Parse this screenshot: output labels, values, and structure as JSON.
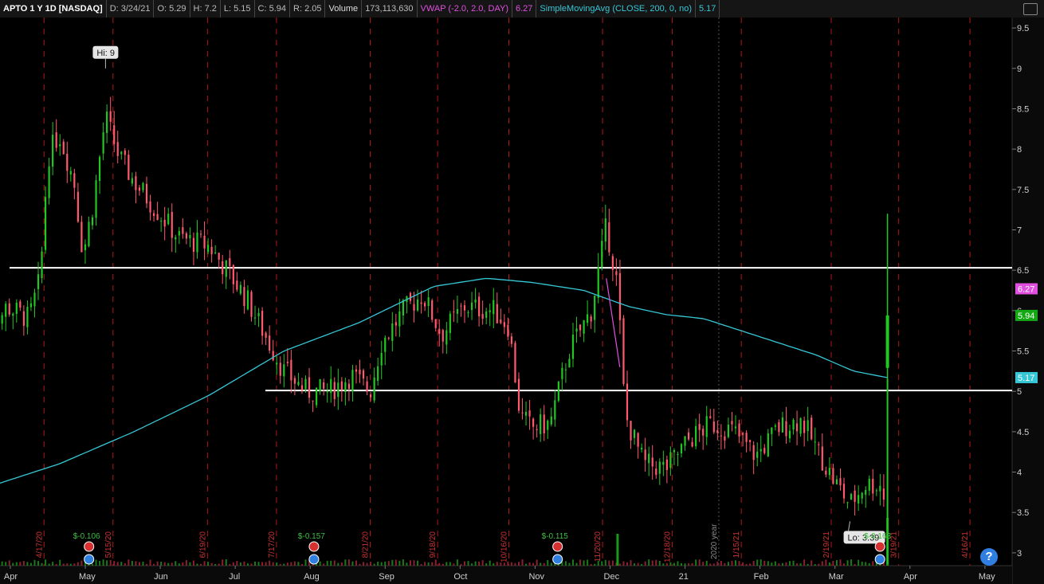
{
  "header": {
    "symbol": "APTO 1 Y 1D [NASDAQ]",
    "date": "D: 3/24/21",
    "open": "O: 5.29",
    "high": "H: 7.2",
    "low": "L: 5.15",
    "close": "C: 5.94",
    "range": "R: 2.05",
    "volume_label": "Volume",
    "volume_value": "173,113,630",
    "vwap_label": "VWAP (-2.0, 2.0, DAY)",
    "vwap_value": "6.27",
    "sma_label": "SimpleMovingAvg (CLOSE, 200, 0, no)",
    "sma_value": "5.17"
  },
  "help_label": "?",
  "chart_data": {
    "type": "candlestick",
    "title": "APTO 1 Y 1D [NASDAQ]",
    "ylim": [
      2.9,
      9.6
    ],
    "y_ticks": [
      "3",
      "3.5",
      "4",
      "4.5",
      "5",
      "5.5",
      "6",
      "6.5",
      "7",
      "7.5",
      "8",
      "8.5",
      "9",
      "9.5"
    ],
    "x_months": [
      {
        "label": "Apr",
        "t": 0.35
      },
      {
        "label": "May",
        "t": 1.35
      },
      {
        "label": "Jun",
        "t": 2.35
      },
      {
        "label": "Jul",
        "t": 3.35
      },
      {
        "label": "Aug",
        "t": 4.35
      },
      {
        "label": "Sep",
        "t": 5.35
      },
      {
        "label": "Oct",
        "t": 6.35
      },
      {
        "label": "Nov",
        "t": 7.35
      },
      {
        "label": "Dec",
        "t": 8.35
      },
      {
        "label": "21",
        "t": 9.35
      },
      {
        "label": "Feb",
        "t": 10.35
      },
      {
        "label": "Mar",
        "t": 11.35
      },
      {
        "label": "Apr",
        "t": 12.35
      },
      {
        "label": "May",
        "t": 13.35
      }
    ],
    "date_markers": [
      {
        "label": "4/17/20",
        "t": 0.8
      },
      {
        "label": "5/15/20",
        "t": 1.72
      },
      {
        "label": "6/19/20",
        "t": 2.98
      },
      {
        "label": "7/17/20",
        "t": 3.9
      },
      {
        "label": "8/21/20",
        "t": 5.15
      },
      {
        "label": "9/18/20",
        "t": 6.05
      },
      {
        "label": "10/16/20",
        "t": 7.0
      },
      {
        "label": "11/20/20",
        "t": 8.25
      },
      {
        "label": "12/18/20",
        "t": 9.18
      },
      {
        "label": "1/15/21",
        "t": 10.1
      },
      {
        "label": "2/19/21",
        "t": 11.3
      },
      {
        "label": "3/19/21",
        "t": 12.2
      },
      {
        "label": "4/16/21",
        "t": 13.15
      }
    ],
    "year_label": {
      "label": "2020 year",
      "t": 9.8
    },
    "horizontal_lines": [
      6.53,
      5.01
    ],
    "hi_marker": {
      "label": "Hi: 9",
      "t": 1.62,
      "price": 9.0
    },
    "lo_marker": {
      "label": "Lo: 3.39",
      "t": 11.55,
      "price": 3.39
    },
    "earnings": [
      {
        "label": "$-0.106",
        "t": 1.4
      },
      {
        "label": "$-0.157",
        "t": 4.4
      },
      {
        "label": "$-0.115",
        "t": 7.65
      },
      {
        "label": "$-0.163",
        "t": 11.95
      }
    ],
    "price_keys": [
      [
        0.0,
        5.6
      ],
      [
        0.3,
        6.05
      ],
      [
        0.6,
        5.9
      ],
      [
        0.75,
        6.4
      ],
      [
        0.85,
        7.9
      ],
      [
        1.0,
        8.2
      ],
      [
        1.2,
        7.6
      ],
      [
        1.32,
        6.7
      ],
      [
        1.45,
        7.3
      ],
      [
        1.62,
        8.4
      ],
      [
        1.8,
        7.9
      ],
      [
        2.0,
        7.6
      ],
      [
        2.3,
        7.25
      ],
      [
        2.6,
        6.9
      ],
      [
        3.0,
        6.8
      ],
      [
        3.2,
        6.55
      ],
      [
        3.5,
        6.15
      ],
      [
        3.8,
        5.6
      ],
      [
        4.0,
        5.25
      ],
      [
        4.3,
        5.0
      ],
      [
        4.6,
        5.0
      ],
      [
        4.9,
        5.2
      ],
      [
        5.15,
        5.0
      ],
      [
        5.3,
        5.6
      ],
      [
        5.6,
        6.0
      ],
      [
        5.85,
        6.2
      ],
      [
        6.1,
        5.7
      ],
      [
        6.4,
        6.05
      ],
      [
        6.8,
        6.0
      ],
      [
        7.0,
        5.8
      ],
      [
        7.15,
        4.7
      ],
      [
        7.3,
        4.55
      ],
      [
        7.55,
        4.6
      ],
      [
        7.8,
        5.5
      ],
      [
        8.1,
        6.0
      ],
      [
        8.3,
        7.05
      ],
      [
        8.45,
        6.3
      ],
      [
        8.55,
        4.7
      ],
      [
        8.8,
        4.1
      ],
      [
        9.1,
        4.05
      ],
      [
        9.4,
        4.4
      ],
      [
        9.7,
        4.6
      ],
      [
        10.0,
        4.5
      ],
      [
        10.3,
        4.2
      ],
      [
        10.6,
        4.55
      ],
      [
        10.9,
        4.65
      ],
      [
        11.1,
        4.3
      ],
      [
        11.3,
        3.95
      ],
      [
        11.55,
        3.6
      ],
      [
        11.75,
        3.85
      ],
      [
        11.95,
        3.85
      ],
      [
        12.0,
        3.7
      ],
      [
        12.05,
        5.94
      ]
    ],
    "sma_keys": [
      [
        0.0,
        3.8
      ],
      [
        1.0,
        4.1
      ],
      [
        2.0,
        4.5
      ],
      [
        3.0,
        4.95
      ],
      [
        4.0,
        5.5
      ],
      [
        5.0,
        5.85
      ],
      [
        6.0,
        6.3
      ],
      [
        6.7,
        6.4
      ],
      [
        7.3,
        6.35
      ],
      [
        8.0,
        6.25
      ],
      [
        8.6,
        6.05
      ],
      [
        9.1,
        5.95
      ],
      [
        9.6,
        5.9
      ],
      [
        10.1,
        5.75
      ],
      [
        10.6,
        5.6
      ],
      [
        11.1,
        5.45
      ],
      [
        11.6,
        5.25
      ],
      [
        12.05,
        5.17
      ]
    ],
    "last_candle": {
      "open": 5.29,
      "high": 7.2,
      "low": 5.15,
      "close": 5.94
    },
    "vwap_line": [
      [
        8.3,
        6.4
      ],
      [
        8.48,
        5.3
      ]
    ],
    "price_badges": [
      {
        "value": "6.27",
        "price": 6.27,
        "color": "#e14fe0"
      },
      {
        "value": "5.94",
        "price": 5.94,
        "color": "#14a814"
      },
      {
        "value": "5.17",
        "price": 5.17,
        "color": "#36c7d6"
      }
    ],
    "up_color": "#22c822",
    "down_color": "#ff5a6e",
    "sma_color": "#36c7d6",
    "vwap_color": "#e14fe0"
  }
}
